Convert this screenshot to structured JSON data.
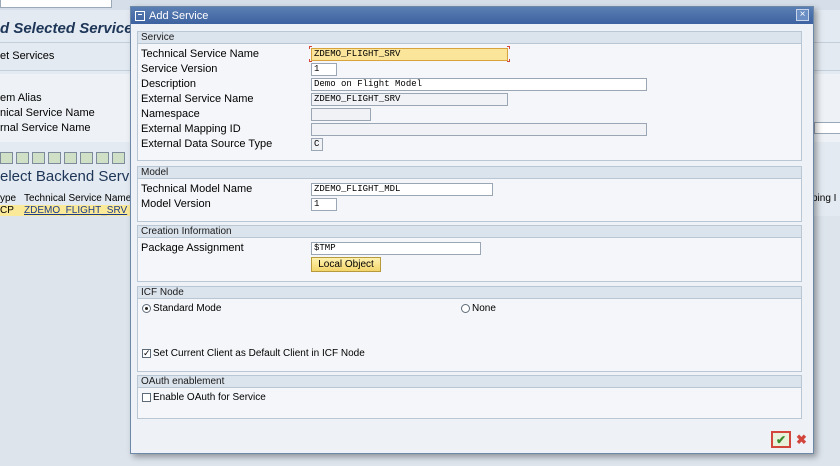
{
  "background": {
    "title": "d Selected Services",
    "select_services": "et Services",
    "labels": [
      "em Alias",
      "nical Service Name",
      "rnal Service Name"
    ],
    "subtitle": "elect Backend Servic",
    "columns": [
      "ype",
      "Technical Service Name"
    ],
    "right_column": "ping I",
    "row": {
      "type": "CP",
      "service": "ZDEMO_FLIGHT_SRV"
    }
  },
  "dialog": {
    "title": "Add Service",
    "close_glyph": "×",
    "service_section": {
      "header": "Service",
      "technical_service_name_label": "Technical Service Name",
      "technical_service_name": "ZDEMO_FLIGHT_SRV",
      "service_version_label": "Service Version",
      "service_version": "1",
      "description_label": "Description",
      "description": "Demo on Flight Model",
      "external_service_name_label": "External Service Name",
      "external_service_name": "ZDEMO_FLIGHT_SRV",
      "namespace_label": "Namespace",
      "namespace": "",
      "external_mapping_id_label": "External Mapping ID",
      "external_mapping_id": "",
      "external_data_source_type_label": "External Data Source Type",
      "external_data_source_type": "C"
    },
    "model_section": {
      "header": "Model",
      "technical_model_name_label": "Technical Model Name",
      "technical_model_name": "ZDEMO_FLIGHT_MDL",
      "model_version_label": "Model Version",
      "model_version": "1"
    },
    "creation_section": {
      "header": "Creation Information",
      "package_assignment_label": "Package Assignment",
      "package_assignment": "$TMP",
      "local_object_button": "Local Object"
    },
    "icf_section": {
      "header": "ICF Node",
      "standard_mode_label": "Standard Mode",
      "standard_mode_selected": true,
      "none_label": "None",
      "default_client_label": "Set Current Client as Default Client in ICF Node",
      "default_client_checked": true
    },
    "oauth_section": {
      "header": "OAuth enablement",
      "enable_oauth_label": "Enable OAuth for Service",
      "enable_oauth_checked": false
    },
    "ok_glyph": "✔",
    "cancel_glyph": "✖"
  },
  "colors": {
    "focus_field": "#fbe59a",
    "confirm_highlight": "#d2463c",
    "titlebar": "#4a6fa8"
  }
}
